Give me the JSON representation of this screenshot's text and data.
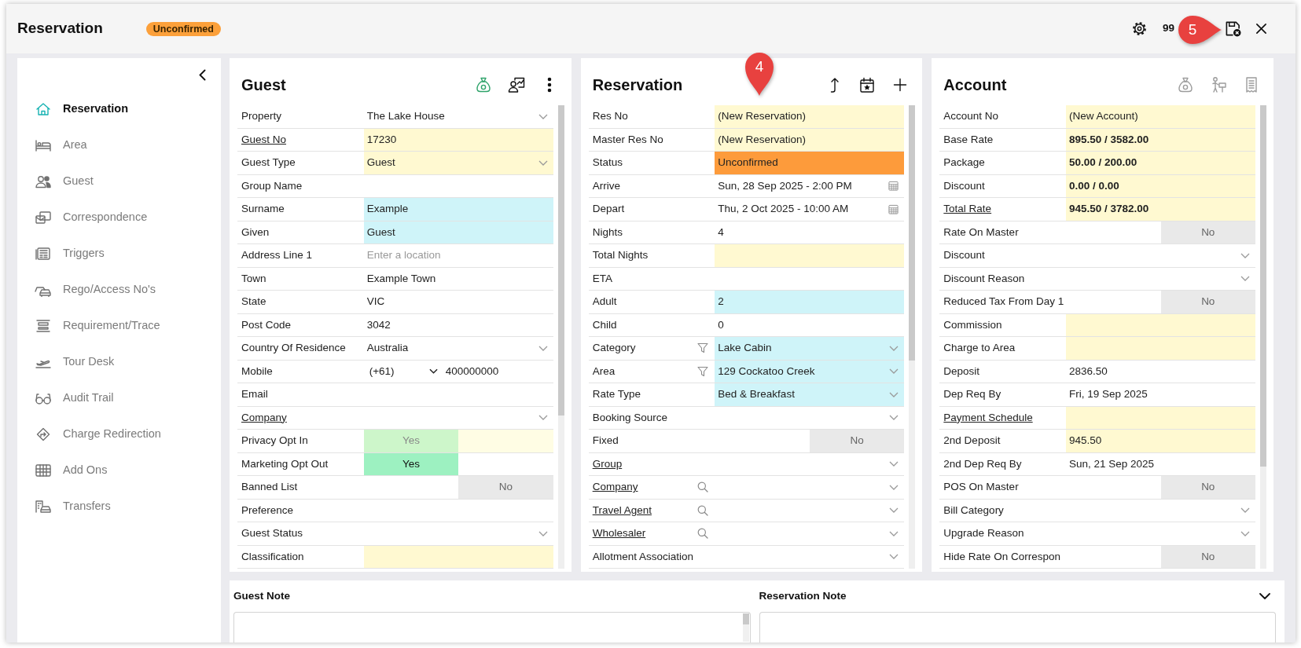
{
  "window": {
    "title": "Reservation",
    "badge": "Unconfirmed",
    "counter": "99"
  },
  "callouts": [
    {
      "number": "4"
    },
    {
      "number": "5"
    }
  ],
  "sidebar": {
    "items": [
      {
        "label": "Reservation",
        "selected": true
      },
      {
        "label": "Area",
        "selected": false
      },
      {
        "label": "Guest",
        "selected": false
      },
      {
        "label": "Correspondence",
        "selected": false
      },
      {
        "label": "Triggers",
        "selected": false
      },
      {
        "label": "Rego/Access No's",
        "selected": false
      },
      {
        "label": "Requirement/Trace",
        "selected": false
      },
      {
        "label": "Tour Desk",
        "selected": false
      },
      {
        "label": "Audit Trail",
        "selected": false
      },
      {
        "label": "Charge Redirection",
        "selected": false
      },
      {
        "label": "Add Ons",
        "selected": false
      },
      {
        "label": "Transfers",
        "selected": false
      }
    ]
  },
  "panels": [
    {
      "title": "Guest",
      "actions": [
        {
          "disabled": false
        },
        {
          "disabled": false
        },
        {
          "disabled": false
        }
      ],
      "rows": [
        {
          "label": "Property",
          "kind": "dropdown",
          "value": "The Lake House"
        },
        {
          "label": "Guest No",
          "link": true,
          "kind": "text",
          "value": "17230",
          "color": "#fff9d1"
        },
        {
          "label": "Guest Type",
          "kind": "dropdown",
          "value": "Guest",
          "color": "#fff9d1"
        },
        {
          "label": "Group Name",
          "kind": "text"
        },
        {
          "label": "Surname",
          "kind": "text",
          "value": "Example",
          "color": "#cff4f9"
        },
        {
          "label": "Given",
          "kind": "text",
          "value": "Guest",
          "color": "#cff4f9"
        },
        {
          "label": "Address Line 1",
          "kind": "text",
          "placeholder": "Enter a location"
        },
        {
          "label": "Town",
          "kind": "text",
          "value": "Example Town"
        },
        {
          "label": "State",
          "kind": "text",
          "value": "VIC"
        },
        {
          "label": "Post Code",
          "kind": "text",
          "value": "3042"
        },
        {
          "label": "Country Of Residence",
          "kind": "dropdown",
          "value": "Australia"
        },
        {
          "label": "Mobile",
          "kind": "phone",
          "prefix": "(+61)",
          "value": "400000000"
        },
        {
          "label": "Email",
          "kind": "text"
        },
        {
          "label": "Company",
          "link": true,
          "kind": "dropdown"
        },
        {
          "label": "Privacy Opt In",
          "kind": "toggle",
          "on": true,
          "disabled": true,
          "value": "Yes",
          "color": "#fffde4"
        },
        {
          "label": "Marketing Opt Out",
          "kind": "toggle",
          "on": true,
          "disabled": false,
          "value": "Yes"
        },
        {
          "label": "Banned List",
          "kind": "toggle",
          "on": false,
          "disabled": false,
          "value": "No"
        },
        {
          "label": "Preference",
          "kind": "text"
        },
        {
          "label": "Guest Status",
          "kind": "dropdown"
        },
        {
          "label": "Classification",
          "kind": "text",
          "color": "#fff9d1"
        }
      ]
    },
    {
      "title": "Reservation",
      "actions": [
        {
          "disabled": false
        },
        {
          "disabled": false
        },
        {
          "disabled": false
        }
      ],
      "rows": [
        {
          "label": "Res No",
          "kind": "text",
          "value": "(New Reservation)",
          "color": "#fff9d1"
        },
        {
          "label": "Master Res No",
          "kind": "text",
          "value": "(New Reservation)",
          "color": "#fff9d1"
        },
        {
          "label": "Status",
          "kind": "text",
          "value": "Unconfirmed",
          "color": "#fd9b3b"
        },
        {
          "label": "Arrive",
          "kind": "date",
          "value": "Sun, 28 Sep 2025 - 2:00 PM"
        },
        {
          "label": "Depart",
          "kind": "date",
          "value": "Thu, 2 Oct 2025 - 10:00 AM"
        },
        {
          "label": "Nights",
          "kind": "text",
          "value": "4"
        },
        {
          "label": "Total Nights",
          "kind": "text",
          "color": "#fff9d1"
        },
        {
          "label": "ETA",
          "kind": "text"
        },
        {
          "label": "Adult",
          "kind": "text",
          "value": "2",
          "color": "#cff4f9"
        },
        {
          "label": "Child",
          "kind": "text",
          "value": "0"
        },
        {
          "label": "Category",
          "kind": "filtered",
          "value": "Lake Cabin",
          "color": "#cff4f9"
        },
        {
          "label": "Area",
          "kind": "filtered",
          "value": "129 Cockatoo Creek",
          "color": "#cff4f9"
        },
        {
          "label": "Rate Type",
          "kind": "dropdown",
          "value": "Bed & Breakfast",
          "color": "#cff4f9"
        },
        {
          "label": "Booking Source",
          "kind": "dropdown"
        },
        {
          "label": "Fixed",
          "kind": "toggle",
          "on": false,
          "disabled": false,
          "value": "No"
        },
        {
          "label": "Group",
          "link": true,
          "kind": "dropdown"
        },
        {
          "label": "Company",
          "link": true,
          "kind": "lookup"
        },
        {
          "label": "Travel Agent",
          "link": true,
          "kind": "lookup"
        },
        {
          "label": "Wholesaler",
          "link": true,
          "kind": "lookup"
        },
        {
          "label": "Allotment Association",
          "kind": "dropdown"
        }
      ]
    },
    {
      "title": "Account",
      "actions": [
        {
          "disabled": true
        },
        {
          "disabled": true
        },
        {
          "disabled": true
        }
      ],
      "rows": [
        {
          "label": "Account No",
          "kind": "text",
          "value": "(New Account)",
          "color": "#fff9d1"
        },
        {
          "label": "Base Rate",
          "kind": "text",
          "value": "895.50 / 3582.00",
          "bold": true,
          "color": "#fff9d1"
        },
        {
          "label": "Package",
          "kind": "text",
          "value": "50.00 / 200.00",
          "bold": true,
          "color": "#fff9d1"
        },
        {
          "label": "Discount",
          "kind": "text",
          "value": "0.00 / 0.00",
          "bold": true,
          "color": "#fff9d1"
        },
        {
          "label": "Total Rate",
          "link": true,
          "kind": "text",
          "value": "945.50 / 3782.00",
          "bold": true,
          "color": "#fff9d1"
        },
        {
          "label": "Rate On Master",
          "kind": "toggle",
          "on": false,
          "disabled": false,
          "value": "No"
        },
        {
          "label": "Discount",
          "kind": "dropdown"
        },
        {
          "label": "Discount Reason",
          "kind": "dropdown"
        },
        {
          "label": "Reduced Tax From Day 1",
          "kind": "toggle",
          "on": false,
          "disabled": false,
          "value": "No"
        },
        {
          "label": "Commission",
          "kind": "text",
          "color": "#fff9d1"
        },
        {
          "label": "Charge to Area",
          "kind": "text",
          "color": "#fff9d1"
        },
        {
          "label": "Deposit",
          "kind": "text",
          "value": "2836.50"
        },
        {
          "label": "Dep Req By",
          "kind": "text",
          "value": "Fri, 19 Sep 2025"
        },
        {
          "label": "Payment Schedule",
          "link": true,
          "kind": "text",
          "color": "#fff9d1"
        },
        {
          "label": "2nd Deposit",
          "kind": "text",
          "value": "945.50",
          "color": "#fff9d1"
        },
        {
          "label": "2nd Dep Req By",
          "kind": "text",
          "value": "Sun, 21 Sep 2025"
        },
        {
          "label": "POS On Master",
          "kind": "toggle",
          "on": false,
          "disabled": false,
          "value": "No"
        },
        {
          "label": "Bill Category",
          "kind": "dropdown"
        },
        {
          "label": "Upgrade Reason",
          "kind": "dropdown"
        },
        {
          "label": "Hide Rate On Correspon",
          "kind": "toggle",
          "on": false,
          "disabled": false,
          "value": "No"
        }
      ]
    }
  ],
  "notes": [
    {
      "title": "Guest Note"
    },
    {
      "title": "Reservation Note"
    }
  ]
}
